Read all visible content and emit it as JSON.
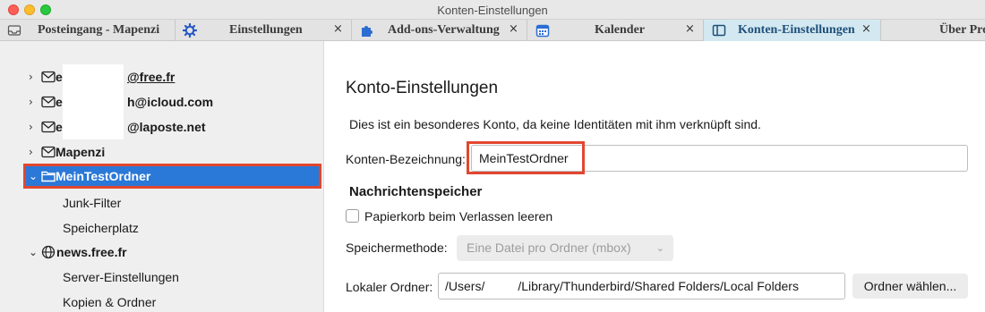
{
  "window": {
    "title": "Konten-Einstellungen"
  },
  "tabs": [
    {
      "label": "Posteingang - Mapenzi",
      "icon": "inbox-icon"
    },
    {
      "label": "Einstellungen",
      "icon": "gear-icon",
      "close": "×"
    },
    {
      "label": "Add-ons-Verwaltung",
      "icon": "puzzle-icon",
      "close": "×"
    },
    {
      "label": "Kalender",
      "icon": "calendar-icon",
      "close": "×"
    },
    {
      "label": "Konten-Einstellungen",
      "icon": "account-settings-icon",
      "close": "×",
      "active": true
    },
    {
      "label": "Über Pro"
    }
  ],
  "sidebar": {
    "accounts": [
      {
        "prefix": "e",
        "suffix": "@free.fr",
        "icon": "mail-icon"
      },
      {
        "prefix": "e",
        "suffix": "h@icloud.com",
        "icon": "mail-icon"
      },
      {
        "prefix": "e",
        "suffix": "@laposte.net",
        "icon": "mail-icon"
      },
      {
        "label": "Mapenzi",
        "icon": "mail-icon"
      },
      {
        "label": "MeinTestOrdner",
        "icon": "folder-icon",
        "selected": true,
        "children": [
          "Junk-Filter",
          "Speicherplatz"
        ]
      },
      {
        "label": "news.free.fr",
        "icon": "globe-icon",
        "children": [
          "Server-Einstellungen",
          "Kopien & Ordner"
        ]
      }
    ]
  },
  "main": {
    "heading": "Konto-Einstellungen",
    "info": "Dies ist ein besonderes Konto, da keine Identitäten mit ihm verknüpft sind.",
    "account_name_label": "Konten-Bezeichnung:",
    "account_name_value": "MeinTestOrdner",
    "storage_section": "Nachrichtenspeicher",
    "empty_trash_label": "Papierkorb beim Verlassen leeren",
    "empty_trash_checked": false,
    "storage_method_label": "Speichermethode:",
    "storage_method_value": "Eine Datei pro Ordner (mbox)",
    "local_folder_label": "Lokaler Ordner:",
    "local_folder_prefix": "/Users/",
    "local_folder_suffix": "/Library/Thunderbird/Shared Folders/Local Folders",
    "choose_folder_button": "Ordner wählen..."
  },
  "colors": {
    "accent": "#2a78d7",
    "highlight": "#e2462f",
    "active_tab": "#d3e8f0"
  }
}
